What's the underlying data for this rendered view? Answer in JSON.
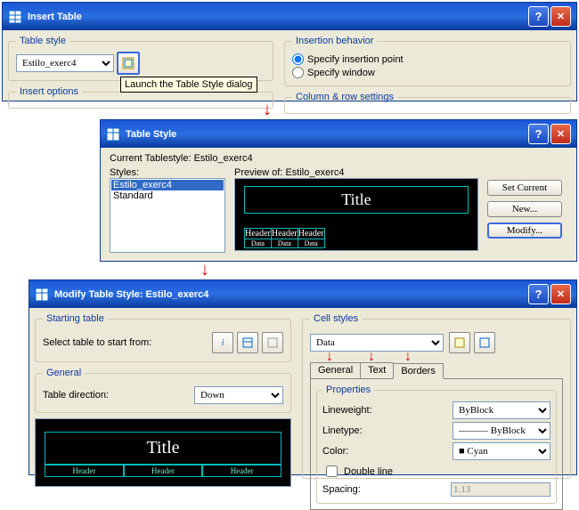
{
  "d1": {
    "title": "Insert Table",
    "fs1": "Table style",
    "style": "Estilo_exerc4",
    "tip": "Launch the Table Style dialog",
    "fs2": "Insert options",
    "fs3": "Insertion behavior",
    "r1": "Specify insertion point",
    "r2": "Specify window",
    "fs4": "Column & row settings"
  },
  "d2": {
    "title": "Table Style",
    "cur": "Current Tablestyle: Estilo_exerc4",
    "styles": "Styles:",
    "prev": "Preview of: Estilo_exerc4",
    "s1": "Estilo_exerc4",
    "s2": "Standard",
    "b1": "Set Current",
    "b2": "New...",
    "b3": "Modify...",
    "pt": "Title",
    "ph": "Header",
    "pd": "Data"
  },
  "d3": {
    "title": "Modify Table Style: Estilo_exerc4",
    "fs1": "Starting table",
    "lbl1": "Select table to start from:",
    "fs2": "General",
    "lbl2": "Table direction:",
    "dir": "Down",
    "fs3": "Cell styles",
    "cstyle": "Data",
    "t1": "General",
    "t2": "Text",
    "t3": "Borders",
    "fs4": "Properties",
    "p1": "Lineweight:",
    "p2": "Linetype:",
    "p3": "Color:",
    "p4": "Double line",
    "p5": "Spacing:",
    "v1": "ByBlock",
    "v2": "ByBlock",
    "v3": "Cyan",
    "sp": "1.13",
    "pt": "Title",
    "ph": "Header"
  }
}
